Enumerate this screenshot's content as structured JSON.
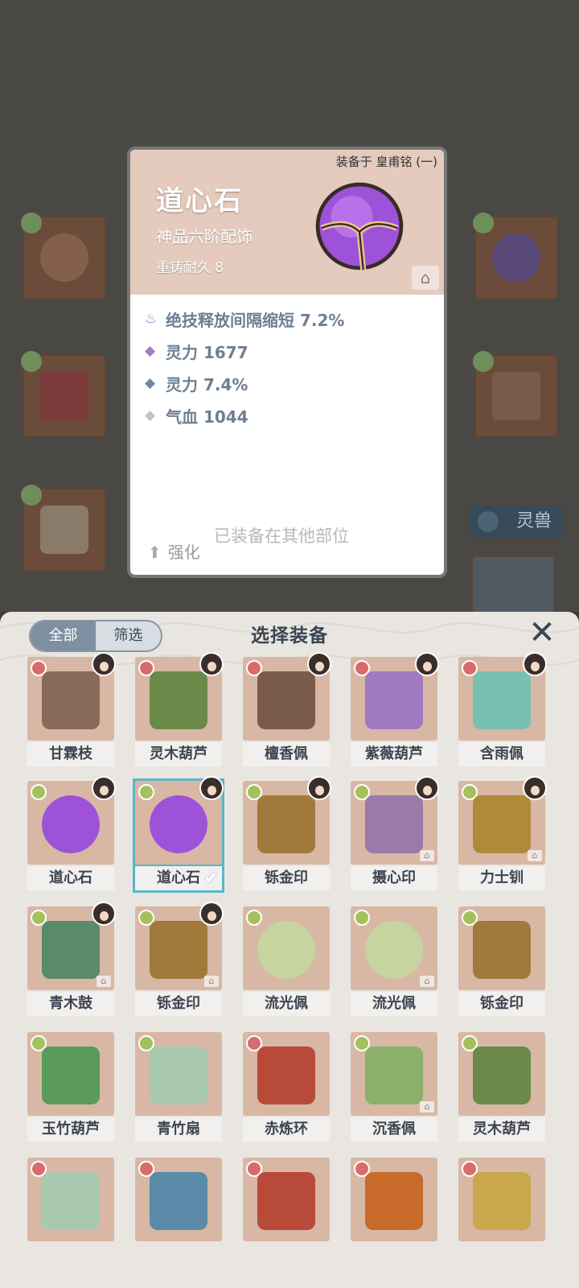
{
  "popup": {
    "equipped_on": "装备于 皇甫铭 (一)",
    "title": "道心石",
    "grade": "神品六阶配饰",
    "reforge": "重铸耐久 8",
    "stats": [
      {
        "icon": "purple-flame-icon",
        "text": "绝技释放间隔缩短 7.2%",
        "color": "#9b72c7"
      },
      {
        "icon": "purple-diamond-icon",
        "text": "灵力 1677",
        "color": "#a57ac6"
      },
      {
        "icon": "blue-diamond-icon",
        "text": "灵力 7.4%",
        "color": "#6f88a4"
      },
      {
        "icon": "gray-diamond-icon",
        "text": "气血 1044",
        "color": "#c4c4c4"
      }
    ],
    "enhance_label": "强化",
    "equipped_msg": "已装备在其他部位"
  },
  "background": {
    "tag_label": "灵兽"
  },
  "sheet": {
    "toggle_all": "全部",
    "toggle_filter": "筛选",
    "title": "选择装备",
    "close_icon": "close-x-icon",
    "items": [
      {
        "name": "甘霖枝",
        "emblem": "red",
        "portrait": true
      },
      {
        "name": "灵木葫芦",
        "emblem": "red",
        "portrait": true
      },
      {
        "name": "檀香佩",
        "emblem": "red",
        "portrait": true
      },
      {
        "name": "紫薇葫芦",
        "emblem": "red",
        "portrait": true
      },
      {
        "name": "含雨佩",
        "emblem": "red",
        "portrait": true
      },
      {
        "name": "道心石",
        "emblem": "green",
        "portrait": true
      },
      {
        "name": "道心石",
        "emblem": "green",
        "portrait": true,
        "selected": true
      },
      {
        "name": "铄金印",
        "emblem": "green",
        "portrait": true
      },
      {
        "name": "摄心印",
        "emblem": "green",
        "portrait": true,
        "lock": true
      },
      {
        "name": "力士钏",
        "emblem": "green",
        "portrait": true,
        "lock": true
      },
      {
        "name": "青木鼓",
        "emblem": "green",
        "portrait": true,
        "lock": true
      },
      {
        "name": "铄金印",
        "emblem": "green",
        "portrait": true,
        "lock": true
      },
      {
        "name": "流光佩",
        "emblem": "green",
        "portrait": false
      },
      {
        "name": "流光佩",
        "emblem": "green",
        "portrait": false,
        "lock": true
      },
      {
        "name": "铄金印",
        "emblem": "green",
        "portrait": false
      },
      {
        "name": "玉竹葫芦",
        "emblem": "green",
        "portrait": false
      },
      {
        "name": "青竹扇",
        "emblem": "green",
        "portrait": false
      },
      {
        "name": "赤炼环",
        "emblem": "red",
        "portrait": false
      },
      {
        "name": "沉香佩",
        "emblem": "green",
        "portrait": false,
        "lock": true
      },
      {
        "name": "灵木葫芦",
        "emblem": "green",
        "portrait": false
      },
      {
        "name": "",
        "emblem": "red",
        "portrait": false
      },
      {
        "name": "",
        "emblem": "red",
        "portrait": false
      },
      {
        "name": "",
        "emblem": "red",
        "portrait": false
      },
      {
        "name": "",
        "emblem": "red",
        "portrait": false
      },
      {
        "name": "",
        "emblem": "red",
        "portrait": false
      }
    ]
  }
}
